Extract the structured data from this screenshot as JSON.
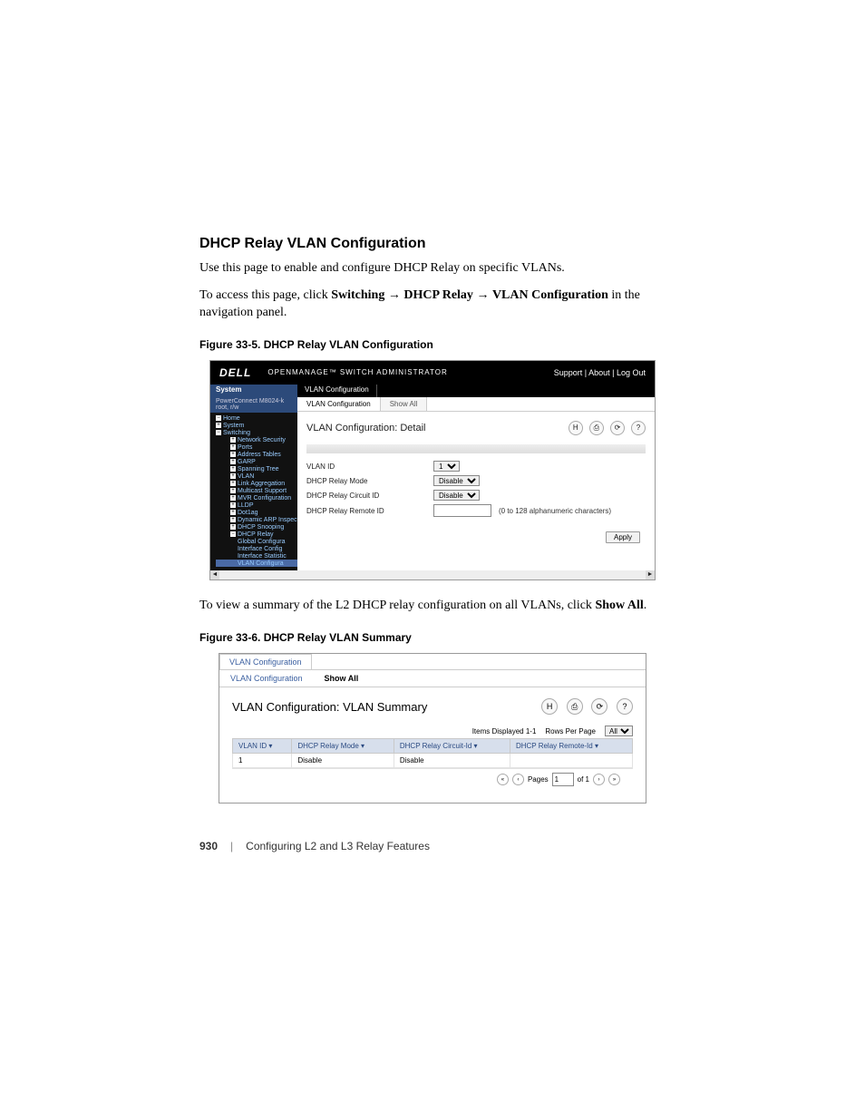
{
  "heading": "DHCP Relay VLAN Configuration",
  "intro": "Use this page to enable and configure DHCP Relay on specific VLANs.",
  "access_prefix": "To access this page, click ",
  "access_bold1": "Switching",
  "access_arrow": " → ",
  "access_bold2": "DHCP Relay",
  "access_bold3": "VLAN Configuration",
  "access_suffix": " in the navigation panel.",
  "fig1_caption": "Figure 33-5.    DHCP Relay VLAN Configuration",
  "shot1": {
    "brand": "DELL",
    "product": "OPENMANAGE™ SWITCH ADMINISTRATOR",
    "toplinks": "Support  |  About  |  Log Out",
    "side_label": "System",
    "side_sub": "PowerConnect M8024-k\nroot, r/w",
    "crumb": "VLAN Configuration",
    "nav": [
      "Home",
      "System",
      "Switching",
      "Network Security",
      "Ports",
      "Address Tables",
      "GARP",
      "Spanning Tree",
      "VLAN",
      "Link Aggregation",
      "Multicast Support",
      "MVR Configuration",
      "LLDP",
      "Dot1ag",
      "Dynamic ARP Inspection",
      "DHCP Snooping",
      "DHCP Relay",
      "Global Configura",
      "Interface Config",
      "Interface Statistic",
      "VLAN Configura"
    ],
    "tabs": {
      "tab1": "VLAN Configuration",
      "tab2": "Show All"
    },
    "panel_title": "VLAN Configuration: Detail",
    "rows": {
      "vlan_id_label": "VLAN ID",
      "vlan_id_value": "1",
      "relay_mode_label": "DHCP Relay Mode",
      "relay_mode_value": "Disable",
      "circuit_label": "DHCP Relay Circuit ID",
      "circuit_value": "Disable",
      "remote_label": "DHCP Relay Remote ID",
      "remote_value": "",
      "remote_hint": "(0 to 128 alphanumeric characters)"
    },
    "apply": "Apply"
  },
  "midtext_prefix": "To view a summary of the L2 DHCP relay configuration on all VLANs, click ",
  "midtext_bold": "Show All",
  "midtext_suffix": ".",
  "fig2_caption": "Figure 33-6.    DHCP Relay VLAN Summary",
  "shot2": {
    "headtab": "VLAN Configuration",
    "tab1": "VLAN Configuration",
    "tab2": "Show All",
    "panel_title": "VLAN Configuration: VLAN Summary",
    "items_displayed": "Items Displayed 1-1",
    "rows_per_page_label": "Rows Per Page",
    "rows_per_page_value": "All",
    "headers": {
      "h1": "VLAN ID",
      "h2": "DHCP Relay Mode",
      "h3": "DHCP Relay Circuit-Id",
      "h4": "DHCP Relay Remote-Id"
    },
    "row": {
      "c1": "1",
      "c2": "Disable",
      "c3": "Disable",
      "c4": ""
    },
    "pager": {
      "pages_label": "Pages",
      "page_value": "1",
      "of": "of 1"
    }
  },
  "footer": {
    "page": "930",
    "chapter": "Configuring L2 and L3 Relay Features"
  }
}
